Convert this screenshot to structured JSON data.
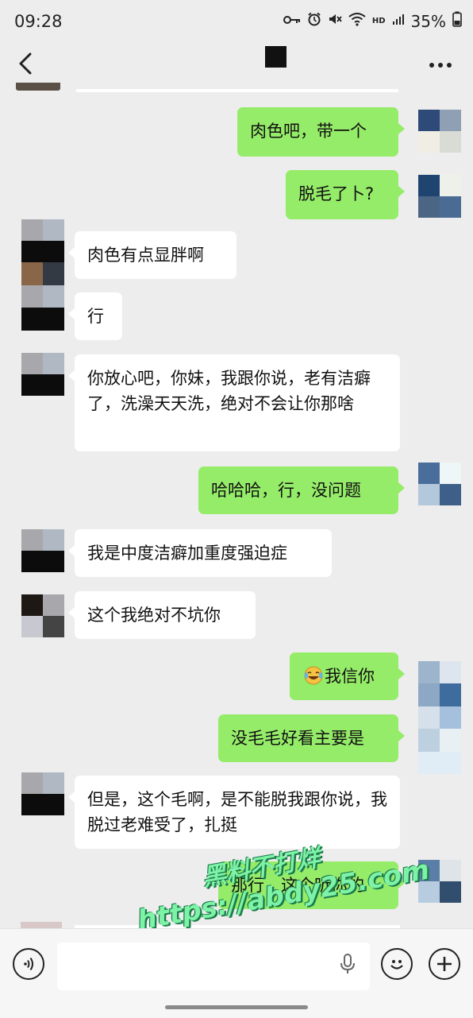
{
  "status_bar": {
    "time": "09:28",
    "battery": "35%",
    "hd_label": "HD"
  },
  "nav": {
    "back_icon": "chevron-left-icon",
    "more_icon": "more-dots-icon"
  },
  "messages": [
    {
      "side": "out",
      "text": "肉色吧，带一个"
    },
    {
      "side": "out",
      "text": "脱毛了卜?"
    },
    {
      "side": "in",
      "text": "肉色有点显胖啊"
    },
    {
      "side": "in",
      "text": "行"
    },
    {
      "side": "in",
      "text": "你放心吧，你妹，我跟你说，老有洁癖了，洗澡天天洗，绝对不会让你那啥"
    },
    {
      "side": "out",
      "text": "哈哈哈，行，没问题"
    },
    {
      "side": "in",
      "text": "我是中度洁癖加重度强迫症"
    },
    {
      "side": "in",
      "text": "这个我绝对不坑你"
    },
    {
      "side": "out",
      "emoji": "😂",
      "text": "我信你"
    },
    {
      "side": "out",
      "text": "没毛毛好看主要是"
    },
    {
      "side": "in",
      "text": "但是，这个毛啊，是不能脱我跟你说，我脱过老难受了，扎挺"
    },
    {
      "side": "out",
      "text": "那行，这个听你的"
    }
  ],
  "watermark": {
    "line1": "黑料不打烊",
    "line2": "https://abdy25.com"
  },
  "input_bar": {
    "voice_icon": "voice-icon",
    "mic_icon": "mic-icon",
    "emoji_icon": "emoji-icon",
    "plus_icon": "plus-icon"
  },
  "colors": {
    "background": "#ededed",
    "outgoing_bubble": "#95ec69",
    "incoming_bubble": "#ffffff"
  }
}
